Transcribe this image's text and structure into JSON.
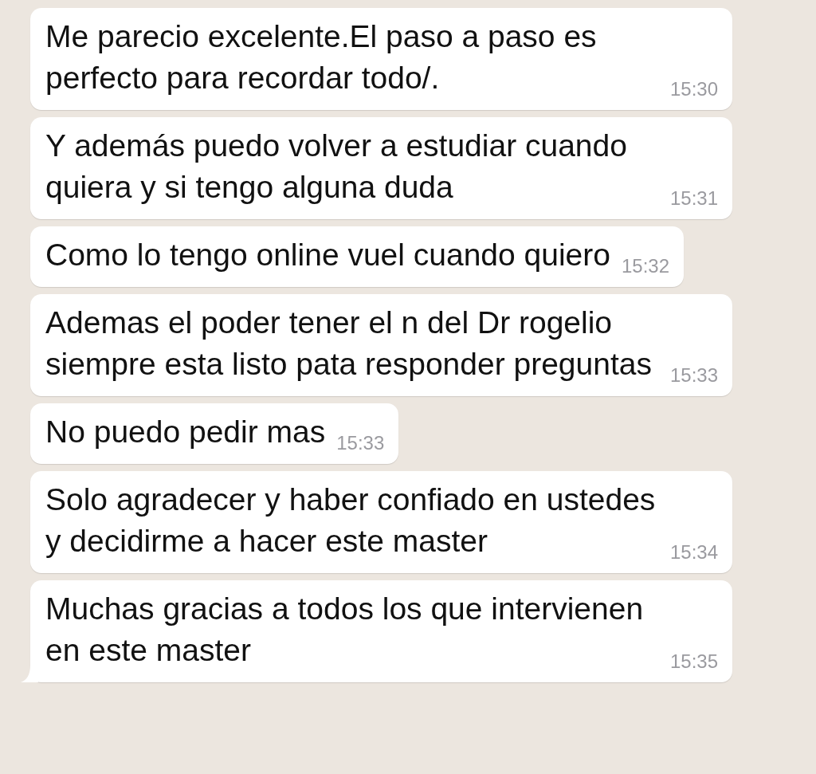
{
  "messages": [
    {
      "text": "Me parecio excelente.El paso a paso es perfecto para recordar todo/.",
      "time": "15:30",
      "tail": false
    },
    {
      "text": "Y además puedo volver a estudiar cuando quiera y si tengo alguna duda",
      "time": "15:31",
      "tail": false
    },
    {
      "text": "Como lo tengo online vuel cuando quiero",
      "time": "15:32",
      "tail": false
    },
    {
      "text": "Ademas el poder tener el n del Dr rogelio siempre esta listo pata responder preguntas",
      "time": "15:33",
      "tail": false
    },
    {
      "text": "No puedo pedir mas",
      "time": "15:33",
      "tail": false
    },
    {
      "text": "Solo agradecer y haber confiado en ustedes y decidirme a hacer este master",
      "time": "15:34",
      "tail": false
    },
    {
      "text": "Muchas gracias a todos los que intervienen en este master",
      "time": "15:35",
      "tail": true
    }
  ]
}
